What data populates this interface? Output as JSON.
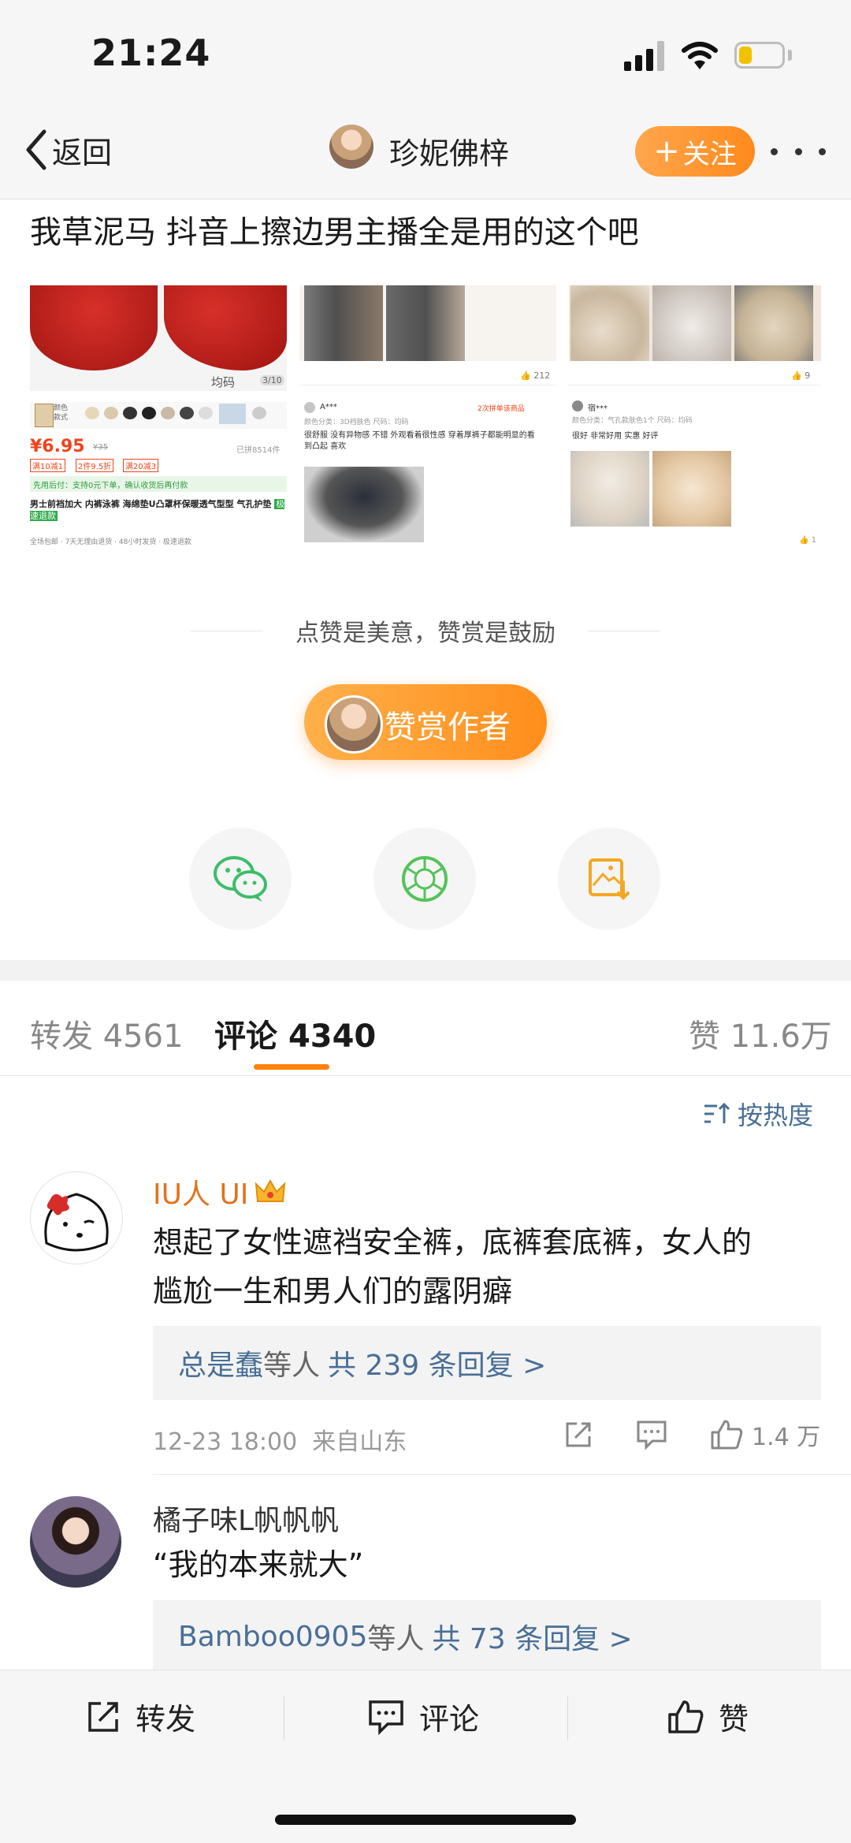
{
  "status_bar": {
    "time": "21:24",
    "battery_level": 0.3
  },
  "nav": {
    "back_label": "返回",
    "author_name": "珍妮佛梓",
    "follow_label": "关注"
  },
  "post": {
    "text": "我草泥马 抖音上擦边男主播全是用的这个吧",
    "image1": {
      "size_label": "均码",
      "page_indicator": "3/10",
      "color_label_1": "颜色",
      "color_label_2": "款式",
      "price": "¥6.95",
      "orig_price": "¥35",
      "sold": "已拼8514件",
      "coupon_1": "满10减1",
      "coupon_2": "2件9.5折",
      "coupon_3": "满20减3",
      "promo": "先用后付：支持0元下单，确认收货后再付款",
      "title": "男士前裆加大 内裤泳裤 海绵垫U凸罩杯保暖透气型型 气孔护垫",
      "tag": "极速退款",
      "footer": "全场包邮 · 7天无理由退货 · 48小时发货 · 极速退款"
    },
    "image2": {
      "likes": "212",
      "user": "A***",
      "badge": "2次拼单该商品",
      "spec": "颜色分类：3D裆肤色  尺码：均码",
      "review": "很舒服 没有异物感 不错 外观看着很性感 穿着厚裤子都能明显的看到凸起 喜欢"
    },
    "image3": {
      "likes": "9",
      "user": "宿***",
      "spec": "颜色分类：气孔款肤色1个  尺码：均码",
      "review": "很好 非常好用 实惠 好评",
      "likes_2": "1"
    }
  },
  "reward": {
    "caption": "点赞是美意，赞赏是鼓励",
    "button_label": "赞赏作者"
  },
  "share_icons": [
    "wechat-icon",
    "moments-icon",
    "save-image-icon"
  ],
  "tabs": {
    "repost_label": "转发",
    "repost_count": "4561",
    "comment_label": "评论",
    "comment_count": "4340",
    "like_label": "赞",
    "like_count": "11.6万"
  },
  "sort_label": "按热度",
  "comments": [
    {
      "name": "IU人 UI",
      "text_line1": "想起了女性遮裆安全裤，底裤套底裤，女人的",
      "text_line2": "尴尬一生和男人们的露阴癖",
      "reply_user": "总是蠢",
      "reply_mid": "等人",
      "reply_count": "共 239 条回复 >",
      "time": "12-23 18:00",
      "location": "来自山东",
      "likes": "1.4 万"
    },
    {
      "name": "橘子味L帆帆帆",
      "text": "“我的本来就大”",
      "reply_user": "Bamboo0905",
      "reply_mid": "等人",
      "reply_count": "共 73 条回复 >"
    }
  ],
  "bottom_bar": {
    "repost": "转发",
    "comment": "评论",
    "like": "赞"
  },
  "colors": {
    "accent_orange": "#ff8a1c",
    "link_blue": "#4a6f96",
    "name_orange": "#e3721d"
  }
}
